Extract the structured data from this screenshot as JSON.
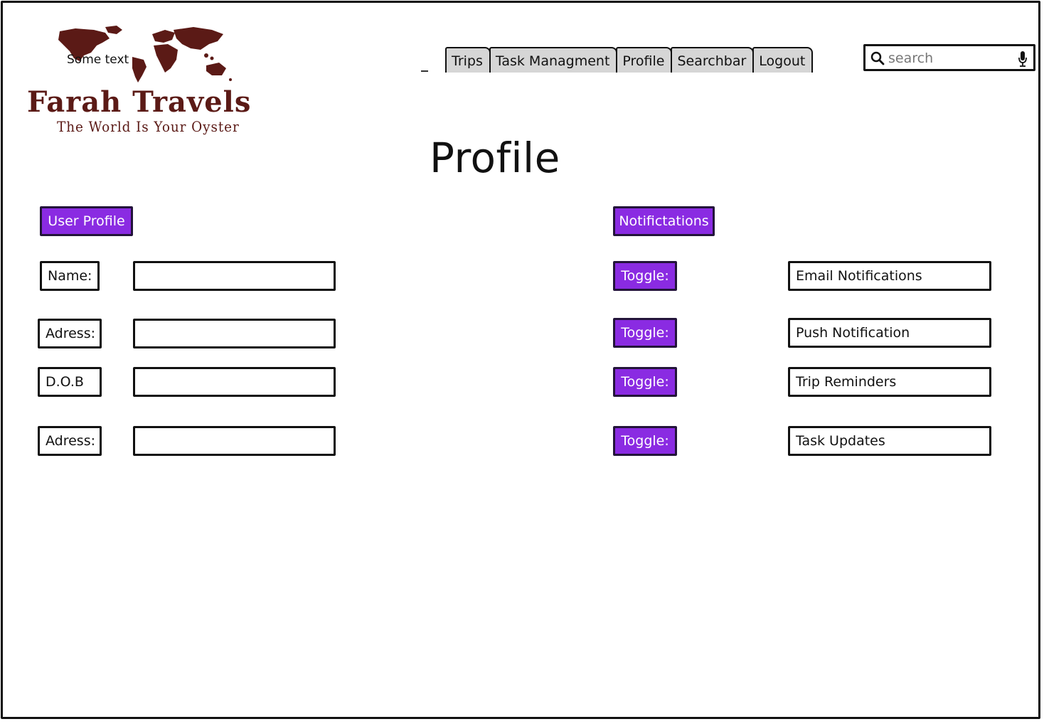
{
  "logo": {
    "overlay_text": "Some text",
    "name": "Farah Travels",
    "tagline": "The World Is Your Oyster",
    "color": "#5b1a16"
  },
  "nav": {
    "tabs": [
      {
        "label": "Trips"
      },
      {
        "label": "Task Managment"
      },
      {
        "label": "Profile"
      },
      {
        "label": "Searchbar"
      },
      {
        "label": "Logout"
      }
    ],
    "tab_color": "#d6d6d6"
  },
  "search": {
    "placeholder": "search",
    "icon": "search-icon",
    "mic_icon": "microphone-icon"
  },
  "page": {
    "title": "Profile"
  },
  "user_profile": {
    "header": "User Profile",
    "fields": [
      {
        "label": "Name:",
        "value": ""
      },
      {
        "label": "Adress:",
        "value": ""
      },
      {
        "label": "D.O.B",
        "value": ""
      },
      {
        "label": "Adress:",
        "value": ""
      }
    ]
  },
  "notifications": {
    "header": "Notifictations",
    "items": [
      {
        "toggle_label": "Toggle:",
        "name": "Email Notifications"
      },
      {
        "toggle_label": "Toggle:",
        "name": "Push Notification"
      },
      {
        "toggle_label": "Toggle:",
        "name": "Trip Reminders"
      },
      {
        "toggle_label": "Toggle:",
        "name": "Task Updates"
      }
    ]
  },
  "colors": {
    "accent": "#8a2be2",
    "border": "#111111"
  }
}
